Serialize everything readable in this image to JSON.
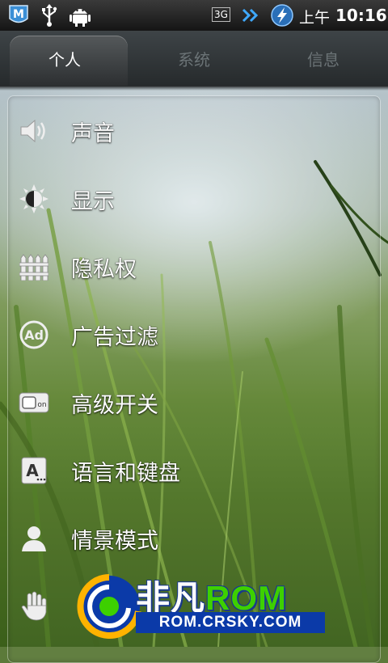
{
  "status_bar": {
    "network_type": "3G",
    "time_prefix": "上午",
    "time": "10:16",
    "icons": [
      "app-m-icon",
      "usb-icon",
      "android-debug-icon",
      "data-transfer-icon",
      "lightning-icon"
    ]
  },
  "tabs": [
    {
      "label": "个人",
      "active": true
    },
    {
      "label": "系统",
      "active": false
    },
    {
      "label": "信息",
      "active": false
    }
  ],
  "settings": {
    "items": [
      {
        "label": "声音",
        "icon": "speaker-icon"
      },
      {
        "label": "显示",
        "icon": "brightness-icon"
      },
      {
        "label": "隐私权",
        "icon": "fence-icon"
      },
      {
        "label": "广告过滤",
        "icon": "ad-block-icon"
      },
      {
        "label": "高级开关",
        "icon": "toggle-on-icon"
      },
      {
        "label": "语言和键盘",
        "icon": "keyboard-letter-icon"
      },
      {
        "label": "情景模式",
        "icon": "person-profile-icon"
      },
      {
        "label": "",
        "icon": "hand-gesture-icon"
      }
    ]
  },
  "watermark": {
    "title_cn": "非凡",
    "title_rom": "ROM",
    "url": "ROM.CRSKY.COM"
  },
  "colors": {
    "status_bar": "#151515",
    "tab_bar": "#2c3032",
    "watermark_blue": "#0b3aa8",
    "watermark_green": "#3dd000"
  }
}
